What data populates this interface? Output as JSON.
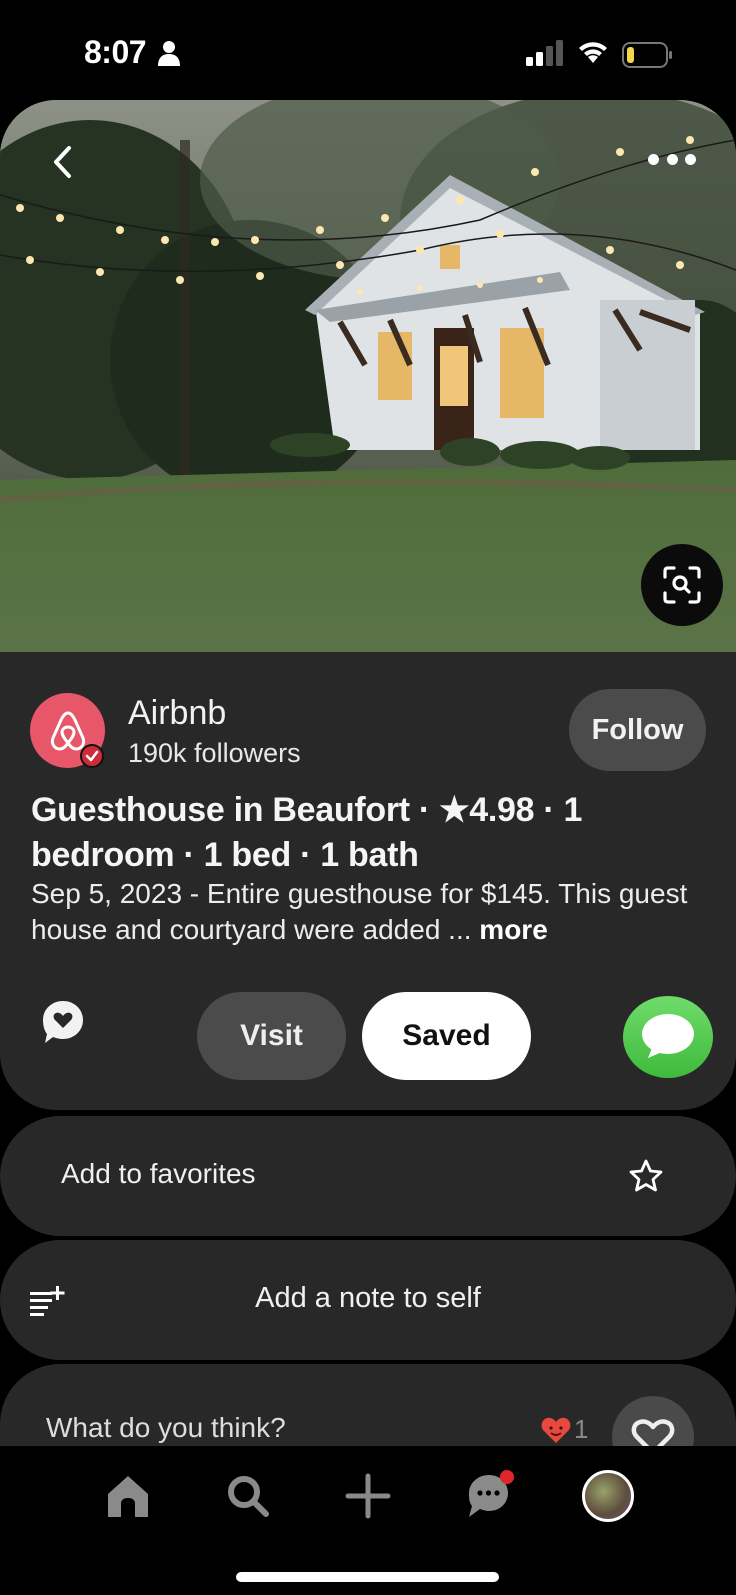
{
  "status_bar": {
    "time": "8:07",
    "icons": [
      "person-icon",
      "cellular-signal-icon",
      "wifi-icon",
      "battery-low-icon"
    ],
    "battery_color": "#f2d64b"
  },
  "hero": {
    "image_alt": "White guesthouse with string lights under moss-draped trees and a green lawn",
    "back_icon": "chevron-left-icon",
    "more_icon": "ellipsis-icon",
    "lens_icon": "visual-search-icon"
  },
  "creator": {
    "name": "Airbnb",
    "followers": "190k followers",
    "follow_label": "Follow",
    "avatar_color": "#e8566a",
    "verified": true
  },
  "pin": {
    "title": "Guesthouse in Beaufort · ★4.98 · 1 bedroom · 1 bed · 1 bath",
    "description": "Sep 5, 2023 - Entire guesthouse for $145. This guest house and courtyard were added ...",
    "more_label": "more"
  },
  "actions": {
    "comment_icon": "comment-heart-icon",
    "visit_label": "Visit",
    "saved_label": "Saved",
    "share_icon": "messages-icon",
    "share_color": "#4fc94c"
  },
  "favorites": {
    "label": "Add to favorites",
    "icon": "star-outline-icon"
  },
  "note": {
    "label": "Add a note to self",
    "icon": "list-add-icon"
  },
  "comments": {
    "prompt": "What do you think?",
    "reaction_count": "1",
    "reaction_icon": "heart-smile-icon",
    "react_icon": "heart-outline-icon"
  },
  "bottom_nav": {
    "items": [
      {
        "name": "home",
        "icon": "home-icon"
      },
      {
        "name": "search",
        "icon": "search-icon"
      },
      {
        "name": "create",
        "icon": "plus-icon"
      },
      {
        "name": "messages",
        "icon": "chat-icon",
        "has_notification": true
      },
      {
        "name": "profile",
        "icon": "profile-avatar"
      }
    ]
  }
}
